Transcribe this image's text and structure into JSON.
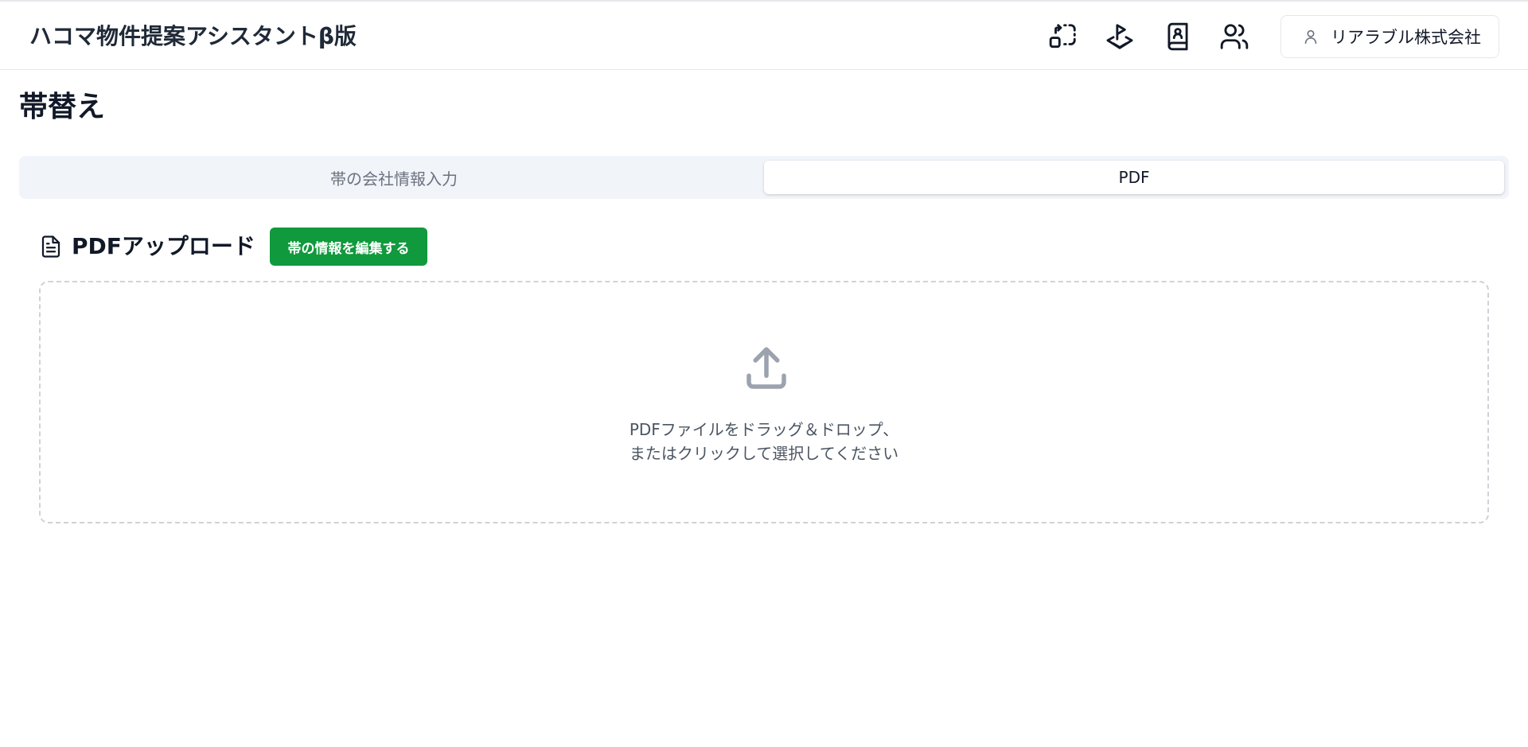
{
  "header": {
    "title": "ハコマ物件提案アシスタントβ版",
    "icons": [
      "rotate-frame-icon",
      "map-pin-layers-icon",
      "contact-book-icon",
      "users-icon"
    ],
    "user_name": "リアラブル株式会社"
  },
  "page": {
    "title": "帯替え"
  },
  "tabs": [
    {
      "label": "帯の会社情報入力",
      "active": false
    },
    {
      "label": "PDF",
      "active": true
    }
  ],
  "upload_section": {
    "title": "PDFアップロード",
    "edit_button_label": "帯の情報を編集する",
    "dropzone_line1": "PDFファイルをドラッグ＆ドロップ、",
    "dropzone_line2": "またはクリックして選択してください"
  },
  "colors": {
    "accent_green": "#109a3d",
    "tab_bar_bg": "#f1f4f8",
    "muted_text": "#6b7280",
    "upload_icon": "#9ca3af"
  }
}
